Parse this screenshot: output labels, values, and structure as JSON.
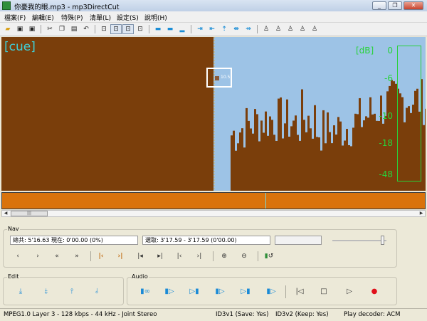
{
  "window": {
    "title": "你憂我的眼.mp3 - mp3DirectCut",
    "controls": [
      "minimize",
      "maximize",
      "close"
    ]
  },
  "menu": [
    {
      "label": "檔案(F)"
    },
    {
      "label": "編輯(E)"
    },
    {
      "label": "特殊(P)"
    },
    {
      "label": "清單(L)"
    },
    {
      "label": "設定(S)"
    },
    {
      "label": "說明(H)"
    }
  ],
  "toolbar": {
    "icons": [
      "open-folder-icon",
      "save-icon",
      "save-as-icon",
      "save-split-icon",
      "cut-icon",
      "copy-icon",
      "paste-icon",
      "undo-icon",
      "zoom-1-icon",
      "zoom-2-icon",
      "zoom-3-icon",
      "zoom-4-icon",
      "cue-bar-icon",
      "cue-bar-2-icon",
      "cue-bar-3-icon",
      "cue-left-icon",
      "cue-right-icon",
      "cue-up-icon",
      "cue-both-icon",
      "cue-mark-icon",
      "person-icon",
      "person-2-icon",
      "person-3-icon",
      "person-4-icon",
      "person-5-icon"
    ]
  },
  "waveform": {
    "cue_label": "[cue]",
    "db_unit": "[dB]",
    "db_ticks": [
      "0",
      "-6",
      "-10",
      "-18",
      "-48"
    ],
    "cursor_value": "10.5",
    "colors": {
      "selection_bg": "#7a3e0b",
      "background": "#9dc3e6",
      "wave": "#7a3e0b",
      "meter": "#28d23a",
      "cue_label": "#3fd0d8",
      "overview": "#d9730b"
    }
  },
  "nav": {
    "group_label": "Nav",
    "total_label": "總共: 5'16.63  現在: 0'00.00  (0%)",
    "selection_label": "選取: 3'17.59 - 3'17.59 (0'00.00)"
  },
  "edit": {
    "group_label": "Edit"
  },
  "audio": {
    "group_label": "Audio"
  },
  "status": {
    "format": "MPEG1.0 Layer 3 - 128 kbps - 44 kHz - Joint Stereo",
    "id3v1": "ID3v1 (Save: Yes)",
    "id3v2": "ID3v2 (Keep: Yes)",
    "decoder": "Play decoder: ACM"
  }
}
